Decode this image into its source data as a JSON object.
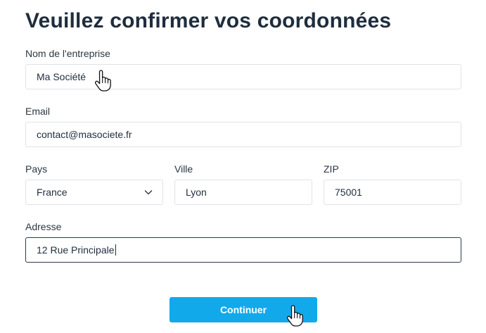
{
  "page": {
    "title": "Veuillez confirmer vos coordonnées"
  },
  "form": {
    "company": {
      "label": "Nom de l'entreprise",
      "value": "Ma Société"
    },
    "email": {
      "label": "Email",
      "value": "contact@masociete.fr"
    },
    "country": {
      "label": "Pays",
      "value": "France"
    },
    "city": {
      "label": "Ville",
      "value": "Lyon"
    },
    "zip": {
      "label": "ZIP",
      "value": "75001"
    },
    "address": {
      "label": "Adresse",
      "value": "12 Rue Principale"
    },
    "submit_label": "Continuer"
  },
  "icons": {
    "select_arrow": "chevron-down-icon",
    "cursor": "hand-pointer-icon"
  },
  "colors": {
    "primary_button": "#12a9eb",
    "title_text": "#1f2d3d",
    "field_border": "#dfe3e8",
    "focused_border": "#2b3a48"
  }
}
